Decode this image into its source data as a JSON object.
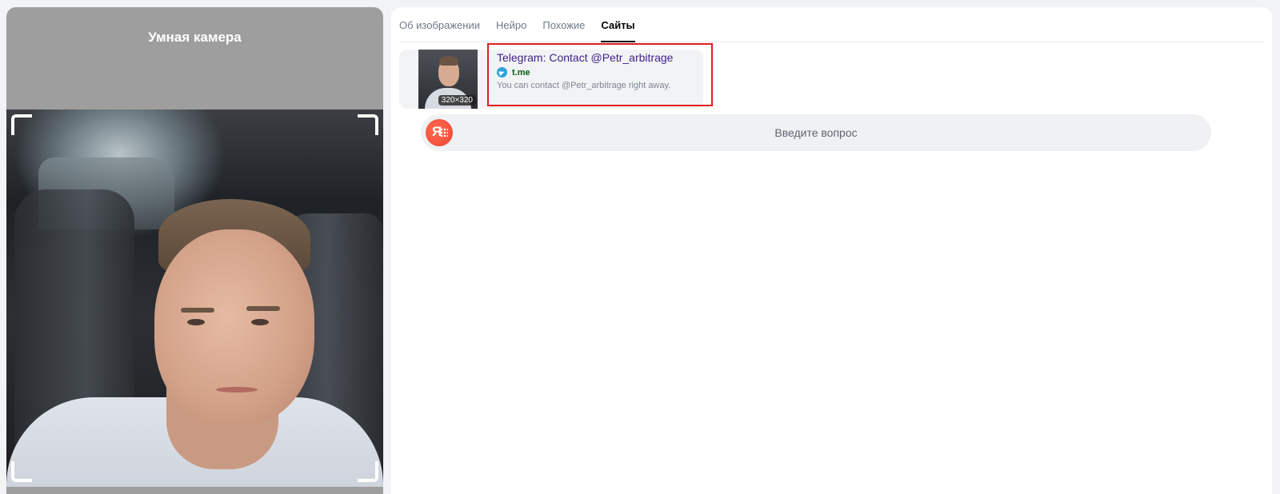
{
  "left_panel": {
    "title": "Умная камера"
  },
  "tabs": [
    {
      "label": "Об изображении",
      "active": false
    },
    {
      "label": "Нейро",
      "active": false
    },
    {
      "label": "Похожие",
      "active": false
    },
    {
      "label": "Сайты",
      "active": true
    }
  ],
  "result": {
    "thumbnail_size": "320×320",
    "title": "Telegram: Contact @Petr_arbitrage",
    "source_icon": "telegram-icon",
    "domain": "t.me",
    "snippet": "You can contact @Petr_arbitrage right away."
  },
  "ask": {
    "placeholder": "Введите вопрос",
    "icon": "alice-icon"
  },
  "colors": {
    "highlight": "#e01e24",
    "title_link": "#3f1f8c",
    "domain": "#0b5c15",
    "alice": "#f0443a",
    "telegram": "#2aa3dd"
  }
}
